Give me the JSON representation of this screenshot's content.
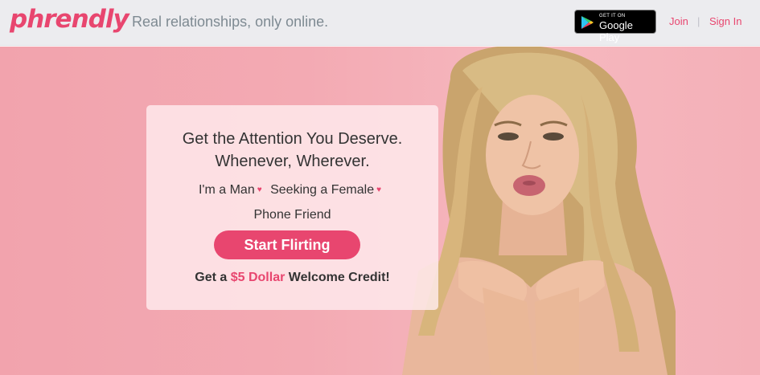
{
  "header": {
    "logo": "phrendly",
    "tagline": "Real relationships, only online.",
    "store_badge": {
      "small": "GET IT ON",
      "big": "Google Play",
      "icon": "google-play-icon"
    },
    "join_label": "Join",
    "separator": "|",
    "signin_label": "Sign In"
  },
  "hero": {
    "headline_line1": "Get the Attention You Deserve.",
    "headline_line2": "Whenever, Wherever.",
    "im_a_label": "I'm a",
    "gender_value": "Man",
    "seeking_label": "Seeking a",
    "seeking_value": "Female",
    "relationship_type": "Phone Friend",
    "cta_label": "Start Flirting",
    "credit_prefix": "Get a",
    "credit_amount": "$5 Dollar",
    "credit_suffix": "Welcome Credit!"
  },
  "colors": {
    "brand": "#e8466f",
    "header_bg": "#ececef",
    "hero_bg": "#f3aab3"
  }
}
